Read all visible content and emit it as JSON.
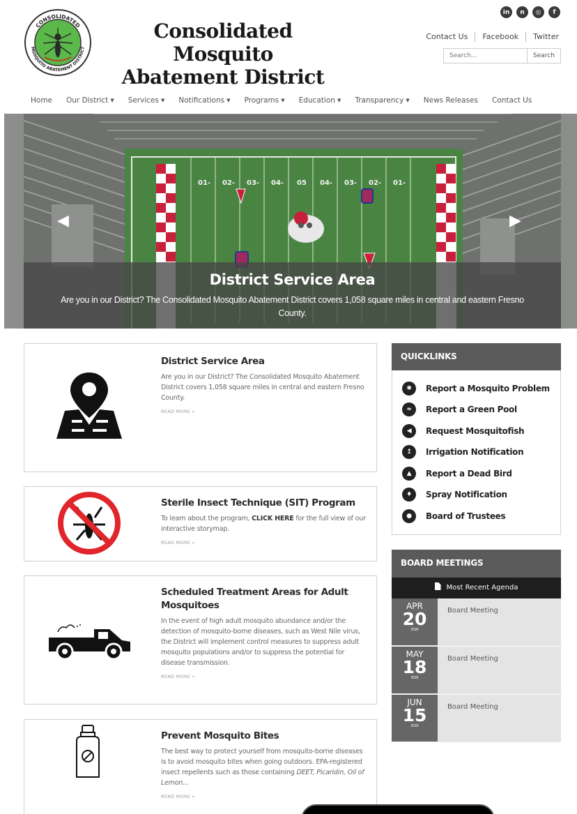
{
  "logo": {
    "ring_top": "CONSOLIDATED",
    "ring_bottom": "MOSQUITO ABATEMENT DISTRICT",
    "colors": {
      "disc": "#5bb84a",
      "ring": "#ffffff"
    }
  },
  "site": {
    "title_line1": "Consolidated Mosquito",
    "title_line2": "Abatement District"
  },
  "social": [
    {
      "name": "linkedin-icon",
      "glyph": "in"
    },
    {
      "name": "nextdoor-icon",
      "glyph": "n"
    },
    {
      "name": "instagram-icon",
      "glyph": "◎"
    },
    {
      "name": "facebook-icon",
      "glyph": "f"
    }
  ],
  "toplinks": [
    "Contact Us",
    "Facebook",
    "Twitter"
  ],
  "search": {
    "placeholder": "Search...",
    "button": "Search"
  },
  "nav": [
    {
      "label": "Home",
      "dropdown": false
    },
    {
      "label": "Our District",
      "dropdown": true
    },
    {
      "label": "Services",
      "dropdown": true
    },
    {
      "label": "Notifications",
      "dropdown": true
    },
    {
      "label": "Programs",
      "dropdown": true
    },
    {
      "label": "Education",
      "dropdown": true
    },
    {
      "label": "Transparency",
      "dropdown": true
    },
    {
      "label": "News Releases",
      "dropdown": false
    },
    {
      "label": "Contact Us",
      "dropdown": false
    }
  ],
  "hero": {
    "title": "District Service Area",
    "text": "Are you in our District? The Consolidated Mosquito Abatement District covers 1,058 square miles in central and eastern Fresno County.",
    "yard_numbers": [
      "01-",
      "02-",
      "03-",
      "04-",
      "05",
      "04-",
      "03-",
      "02-",
      "01-"
    ]
  },
  "cards": [
    {
      "title": "District Service Area",
      "text": "Are you in our District? The Consolidated Mosquito Abatement District covers 1,058 square miles in central and eastern Fresno County.",
      "readmore": "READ MORE »"
    },
    {
      "title": "Sterile Insect Technique (SIT) Program",
      "text_before": "To learn about the program, ",
      "text_bold": "CLICK HERE",
      "text_after": " for the full view of our interactive storymap.",
      "readmore": "READ MORE »"
    },
    {
      "title": "Scheduled Treatment Areas for Adult Mosquitoes",
      "text": "In the event of high adult mosquito abundance and/or the detection of mosquito-borne diseases, such as West Nile virus, the District will implement control measures to suppress adult mosquito populations and/or to suppress the potential for disease transmission.",
      "readmore": "READ MORE »"
    },
    {
      "title": "Prevent Mosquito Bites",
      "text": "The best way to protect yourself from mosquito-borne diseases is to avoid mosquito bites when going outdoors. EPA-registered insect repellents such as those containing",
      "text_italic": "DEET, Picaridin, Oil of Lemon...",
      "readmore": "READ MORE »"
    }
  ],
  "quicklinks": {
    "heading": "QUICKLINKS",
    "items": [
      {
        "label": "Report a Mosquito Problem",
        "icon": "mosquito-icon"
      },
      {
        "label": "Report a Green Pool",
        "icon": "pool-icon"
      },
      {
        "label": "Request Mosquitofish",
        "icon": "fish-icon"
      },
      {
        "label": "Irrigation Notification",
        "icon": "irrigation-icon"
      },
      {
        "label": "Report a Dead Bird",
        "icon": "bird-icon"
      },
      {
        "label": "Spray Notification",
        "icon": "spray-icon"
      },
      {
        "label": "Board of Trustees",
        "icon": "trustees-icon"
      }
    ]
  },
  "board": {
    "heading": "BOARD MEETINGS",
    "agenda": "Most Recent Agenda",
    "meetings": [
      {
        "month": "APR",
        "day": "20",
        "year": "2026",
        "title": "Board Meeting"
      },
      {
        "month": "MAY",
        "day": "18",
        "year": "2026",
        "title": "Board Meeting"
      },
      {
        "month": "JUN",
        "day": "15",
        "year": "2026",
        "title": "Board Meeting"
      }
    ]
  }
}
